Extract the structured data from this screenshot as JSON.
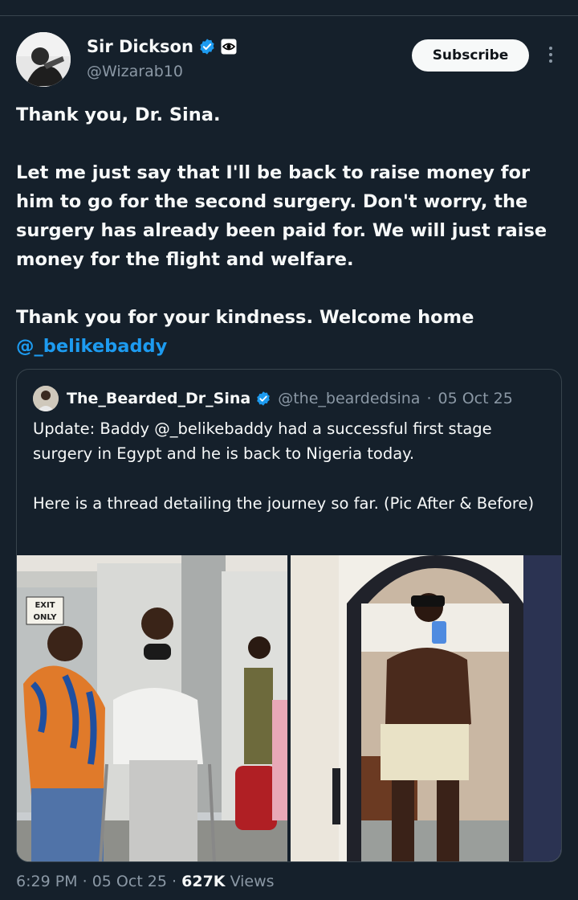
{
  "author": {
    "display_name": "Sir Dickson",
    "handle": "@Wizarab10",
    "verified": true,
    "affiliation_icon": "eye-badge-icon"
  },
  "subscribe_label": "Subscribe",
  "more_icon": "more-vertical-icon",
  "tweet": {
    "line1": "Thank you, Dr. Sina.",
    "paragraph2": "Let me just say that I'll be back to raise money for him to go for the second surgery. Don't worry, the surgery has already been paid for. We will just raise money for the flight and welfare.",
    "paragraph3_text": "Thank you for your kindness. Welcome home",
    "paragraph3_mention": "@_belikebaddy"
  },
  "quoted": {
    "display_name": "The_Bearded_Dr_Sina",
    "handle": "@the_beardedsina",
    "separator": "·",
    "date": "05 Oct 25",
    "verified": true,
    "text1": "Update: Baddy @_belikebaddy had a successful first stage surgery in Egypt and he is back to Nigeria today.",
    "text2": "Here is a thread detailing the journey so far. (Pic After & Before)",
    "photo1_signs": {
      "exit": "EXIT",
      "only": "ONLY"
    }
  },
  "footer": {
    "time": "6:29 PM",
    "sep1": "·",
    "date": "05 Oct 25",
    "sep2": "·",
    "views_count": "627K",
    "views_label": "Views"
  },
  "colors": {
    "background": "#15202b",
    "text": "#f7f9f9",
    "secondary": "#8b98a5",
    "accent": "#1d9bf0",
    "border": "#38444d"
  }
}
